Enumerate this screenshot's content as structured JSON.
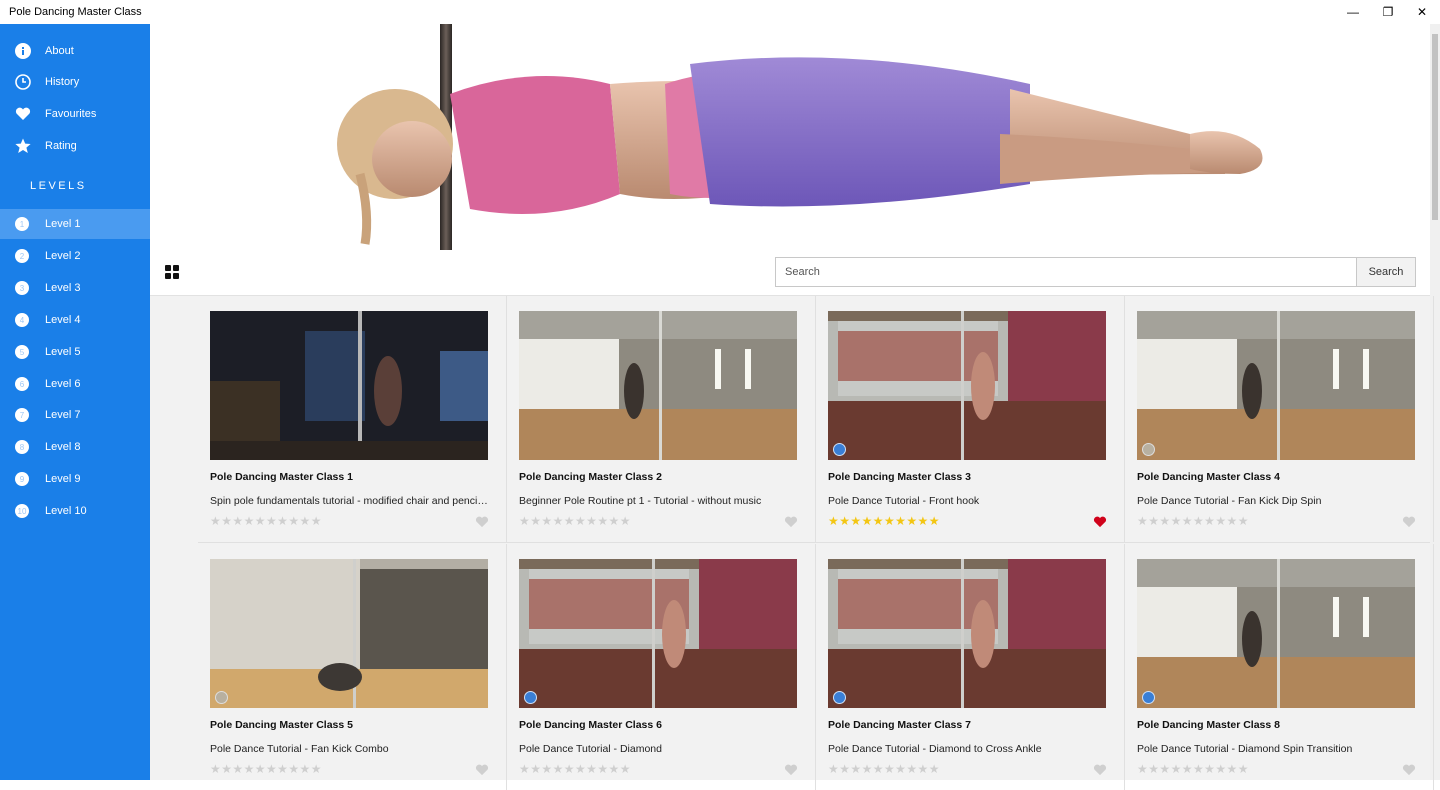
{
  "window": {
    "title": "Pole Dancing Master Class",
    "minimize_glyph": "—",
    "maximize_glyph": "❐",
    "close_glyph": "✕"
  },
  "sidebar": {
    "nav": [
      {
        "label": "About",
        "icon": "info-icon"
      },
      {
        "label": "History",
        "icon": "clock-icon"
      },
      {
        "label": "Favourites",
        "icon": "heart-icon"
      },
      {
        "label": "Rating",
        "icon": "star-icon"
      }
    ],
    "levels_heading": "LEVELS",
    "levels": [
      {
        "num": "1",
        "label": "Level 1",
        "active": true
      },
      {
        "num": "2",
        "label": "Level 2"
      },
      {
        "num": "3",
        "label": "Level 3"
      },
      {
        "num": "4",
        "label": "Level 4"
      },
      {
        "num": "5",
        "label": "Level 5"
      },
      {
        "num": "6",
        "label": "Level 6"
      },
      {
        "num": "7",
        "label": "Level 7"
      },
      {
        "num": "8",
        "label": "Level 8"
      },
      {
        "num": "9",
        "label": "Level 9"
      },
      {
        "num": "10",
        "label": "Level 10"
      }
    ]
  },
  "toolbar": {
    "search_placeholder": "Search",
    "search_button": "Search",
    "view_icon": "grid-view-icon"
  },
  "colors": {
    "sidebar": "#1a7fe8",
    "active_level": "#4a9bf0",
    "star_on": "#f3c613",
    "star_off": "#cfcfcf",
    "heart_on": "#d0021b",
    "heart_off": "#cfcfcf"
  },
  "cards": [
    {
      "title": "Pole Dancing Master Class 1",
      "desc": "Spin pole fundamentals tutorial - modified chair and pencil spin",
      "rating": 0,
      "favourite": false,
      "scene": "dark"
    },
    {
      "title": "Pole Dancing Master Class 2",
      "desc": "Beginner Pole Routine pt 1 - Tutorial - without music",
      "rating": 0,
      "favourite": false,
      "scene": "studio"
    },
    {
      "title": "Pole Dancing Master Class 3",
      "desc": "Pole Dance Tutorial - Front hook",
      "rating": 10,
      "favourite": true,
      "scene": "window"
    },
    {
      "title": "Pole Dancing Master Class 4",
      "desc": "Pole Dance Tutorial - Fan Kick Dip Spin",
      "rating": 0,
      "favourite": false,
      "scene": "studio"
    },
    {
      "title": "Pole Dancing Master Class 5",
      "desc": "Pole Dance Tutorial - Fan Kick Combo",
      "rating": 0,
      "favourite": false,
      "scene": "curtain"
    },
    {
      "title": "Pole Dancing Master Class 6",
      "desc": "Pole Dance Tutorial - Diamond",
      "rating": 0,
      "favourite": false,
      "scene": "window"
    },
    {
      "title": "Pole Dancing Master Class 7",
      "desc": "Pole Dance Tutorial - Diamond to Cross Ankle",
      "rating": 0,
      "favourite": false,
      "scene": "window"
    },
    {
      "title": "Pole Dancing Master Class 8",
      "desc": "Pole Dance Tutorial - Diamond Spin Transition",
      "rating": 0,
      "favourite": false,
      "scene": "studio"
    }
  ]
}
